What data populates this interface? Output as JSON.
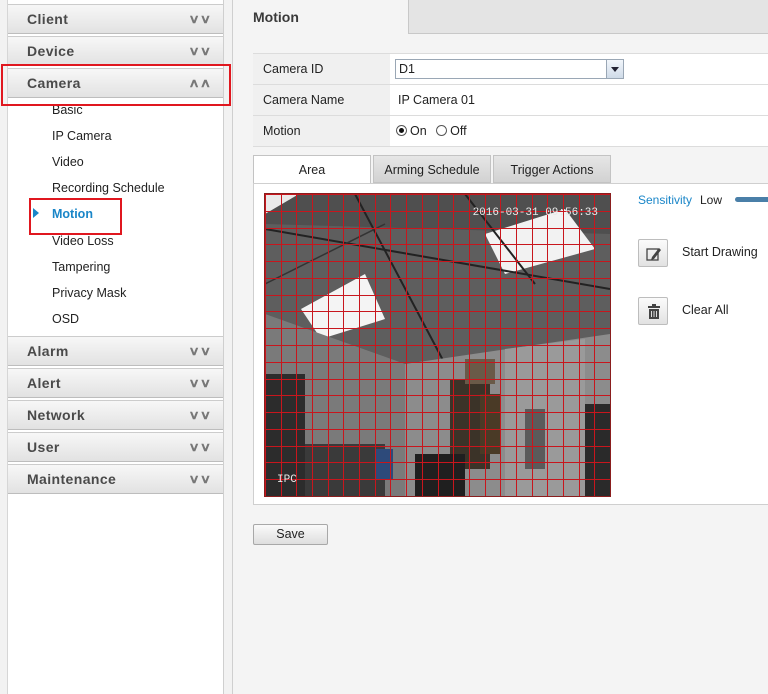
{
  "sidebar": {
    "sections": [
      {
        "label": "Client"
      },
      {
        "label": "Device"
      },
      {
        "label": "Camera"
      },
      {
        "label": "Alarm"
      },
      {
        "label": "Alert"
      },
      {
        "label": "Network"
      },
      {
        "label": "User"
      },
      {
        "label": "Maintenance"
      }
    ],
    "camera_items": [
      {
        "label": "Basic"
      },
      {
        "label": "IP Camera"
      },
      {
        "label": "Video"
      },
      {
        "label": "Recording Schedule"
      },
      {
        "label": "Motion"
      },
      {
        "label": "Video Loss"
      },
      {
        "label": "Tampering"
      },
      {
        "label": "Privacy Mask"
      },
      {
        "label": "OSD"
      }
    ],
    "active_item": "Motion",
    "icons": {
      "collapsed": "double-chevron-down-icon",
      "expanded": "double-chevron-up-icon"
    }
  },
  "main": {
    "tab": "Motion",
    "form": {
      "camera_id_label": "Camera ID",
      "camera_id_value": "D1",
      "camera_name_label": "Camera Name",
      "camera_name_value": "IP Camera 01",
      "motion_label": "Motion",
      "on_label": "On",
      "off_label": "Off",
      "motion_state": "On"
    },
    "subtabs": [
      {
        "label": "Area"
      },
      {
        "label": "Arming Schedule"
      },
      {
        "label": "Trigger Actions"
      }
    ],
    "active_subtab": "Area",
    "video": {
      "timestamp": "2016-03-31 09:56:33",
      "channel_name": "IPC"
    },
    "sensitivity_label": "Sensitivity",
    "sensitivity_value": "Low",
    "start_drawing_label": "Start Drawing",
    "clear_all_label": "Clear All",
    "save_label": "Save"
  },
  "colors": {
    "accent": "#1a86c8",
    "highlight": "#e0171f",
    "grid": "#c8161d"
  }
}
